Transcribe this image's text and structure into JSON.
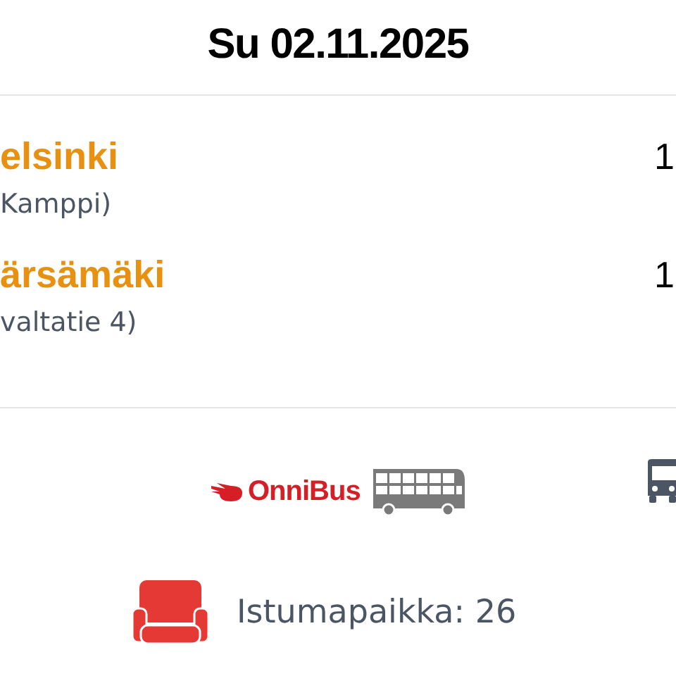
{
  "date": "Su 02.11.2025",
  "stops": [
    {
      "name": "elsinki",
      "place": "Kamppi)",
      "time": "1"
    },
    {
      "name": "ärsämäki",
      "place": "valtatie 4)",
      "time": "1"
    }
  ],
  "operator": {
    "logo": "OnniBus"
  },
  "seat": {
    "label": "Istumapaikka: 26"
  }
}
